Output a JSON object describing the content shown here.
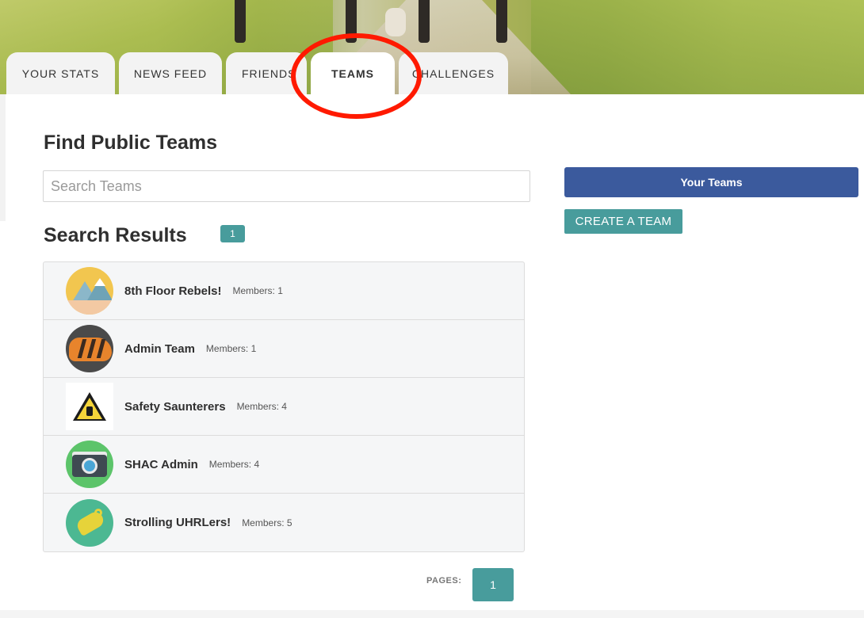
{
  "tabs": [
    {
      "label": "YOUR STATS",
      "active": false
    },
    {
      "label": "NEWS FEED",
      "active": false
    },
    {
      "label": "FRIENDS",
      "active": false
    },
    {
      "label": "TEAMS",
      "active": true
    },
    {
      "label": "CHALLENGES",
      "active": false
    }
  ],
  "find": {
    "title": "Find Public Teams",
    "search_placeholder": "Search Teams",
    "search_value": ""
  },
  "results": {
    "title": "Search Results",
    "count": "1",
    "teams": [
      {
        "name": "8th Floor Rebels!",
        "members": "Members: 1",
        "icon": "mountains-icon"
      },
      {
        "name": "Admin Team",
        "members": "Members: 1",
        "icon": "tiger-icon"
      },
      {
        "name": "Safety Saunterers",
        "members": "Members: 4",
        "icon": "caution-sign-icon"
      },
      {
        "name": "SHAC Admin",
        "members": "Members: 4",
        "icon": "camera-icon"
      },
      {
        "name": "Strolling UHRLers!",
        "members": "Members: 5",
        "icon": "whistle-icon"
      }
    ]
  },
  "pagination": {
    "label": "PAGES:",
    "current": "1"
  },
  "sidebar": {
    "your_teams_label": "Your Teams",
    "create_team_label": "CREATE A TEAM"
  },
  "colors": {
    "teal": "#489c9c",
    "blue": "#3b5a9d",
    "annotation": "#ff1a00"
  }
}
